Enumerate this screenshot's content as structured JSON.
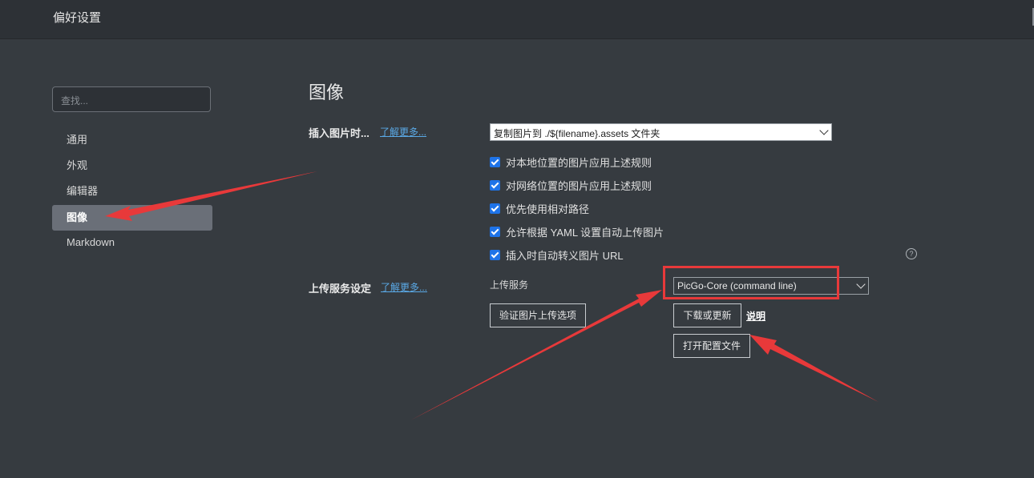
{
  "window": {
    "title": "偏好设置"
  },
  "sidebar": {
    "search_placeholder": "查找...",
    "items": [
      {
        "label": "通用"
      },
      {
        "label": "外观"
      },
      {
        "label": "编辑器"
      },
      {
        "label": "图像",
        "active": true
      },
      {
        "label": "Markdown"
      }
    ]
  },
  "main": {
    "section_title": "图像",
    "insert": {
      "label": "插入图片时...",
      "learn_more": "了解更多...",
      "select_value": "复制图片到 ./${filename}.assets 文件夹",
      "options": [
        {
          "label": "对本地位置的图片应用上述规则",
          "checked": true
        },
        {
          "label": "对网络位置的图片应用上述规则",
          "checked": true
        },
        {
          "label": "优先使用相对路径",
          "checked": true
        },
        {
          "label": "允许根据 YAML 设置自动上传图片",
          "checked": true
        },
        {
          "label": "插入时自动转义图片 URL",
          "checked": true
        }
      ],
      "help_icon": "question-circle-icon"
    },
    "upload": {
      "label": "上传服务设定",
      "learn_more": "了解更多...",
      "service_label": "上传服务",
      "service_value": "PicGo-Core (command line)",
      "verify_button": "验证图片上传选项",
      "download_button": "下载或更新",
      "explain_link": "说明",
      "open_config_button": "打开配置文件"
    }
  },
  "annotations": {
    "color": "#e8393a"
  },
  "colors": {
    "background": "#363b40",
    "accent": "#1e73e8",
    "link": "#5aa9e6"
  }
}
